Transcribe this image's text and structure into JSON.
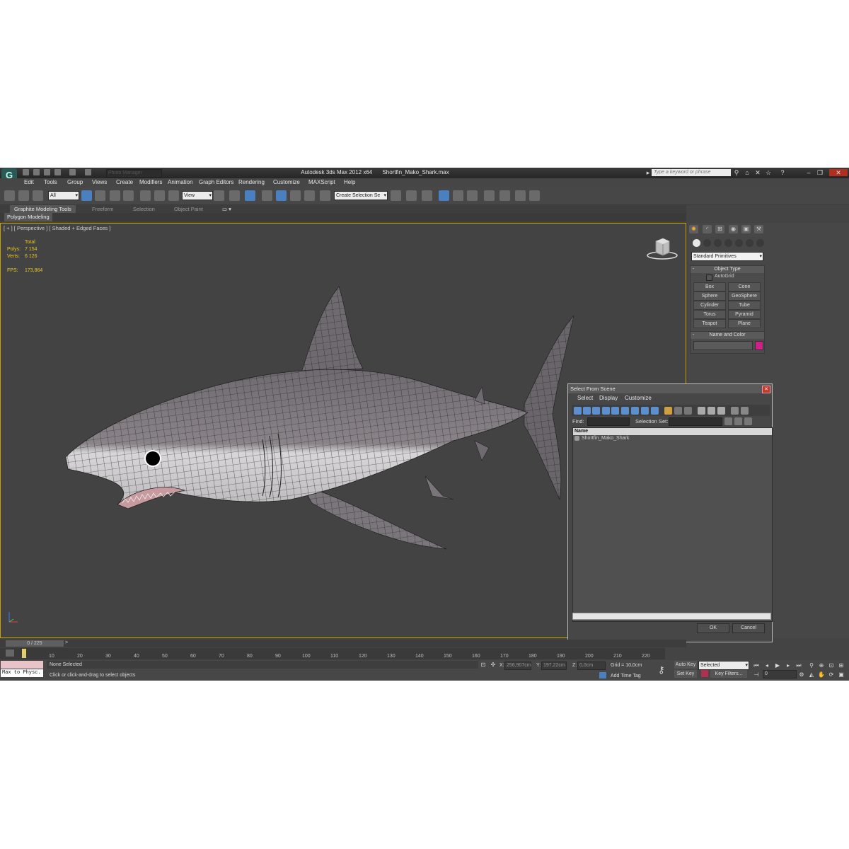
{
  "window": {
    "app_title": "Autodesk 3ds Max  2012 x64",
    "file_name": "Shortfin_Mako_Shark.max",
    "project_placeholder": "Photo Manager",
    "search_placeholder": "Type a keyword or phrase"
  },
  "menu": [
    "Edit",
    "Tools",
    "Group",
    "Views",
    "Create",
    "Modifiers",
    "Animation",
    "Graph Editors",
    "Rendering",
    "Customize",
    "MAXScript",
    "Help"
  ],
  "toolbar": {
    "filter_value": "All",
    "ref_coord_value": "View",
    "selection_set_placeholder": "Create Selection Se"
  },
  "ribbon": {
    "tabs": [
      "Graphite Modeling Tools",
      "Freeform",
      "Selection",
      "Object Paint"
    ],
    "panel": "Polygon Modeling"
  },
  "viewport": {
    "label": "[ + ] [ Perspective ] [ Shaded + Edged Faces ]",
    "stats": {
      "total_label": "Total",
      "polys_label": "Polys:",
      "polys_value": "7 154",
      "verts_label": "Verts:",
      "verts_value": "6 126",
      "fps_label": "FPS:",
      "fps_value": "173,864"
    }
  },
  "command_panel": {
    "category": "Standard Primitives",
    "object_type_title": "Object Type",
    "autogrid_label": "AutoGrid",
    "primitives": [
      "Box",
      "Cone",
      "Sphere",
      "GeoSphere",
      "Cylinder",
      "Tube",
      "Torus",
      "Pyramid",
      "Teapot",
      "Plane"
    ],
    "name_color_title": "Name and Color",
    "object_color": "#cc2288"
  },
  "dialog": {
    "title": "Select From Scene",
    "menus": [
      "Select",
      "Display",
      "Customize"
    ],
    "find_label": "Find:",
    "selection_set_label": "Selection Set:",
    "column_name": "Name",
    "items": [
      "Shortfin_Mako_Shark"
    ],
    "ok_label": "OK",
    "cancel_label": "Cancel"
  },
  "timeline": {
    "frame_display": "0 / 225",
    "ticks": [
      "0",
      "10",
      "20",
      "30",
      "40",
      "50",
      "60",
      "70",
      "80",
      "90",
      "100",
      "110",
      "120",
      "130",
      "140",
      "150",
      "160",
      "170",
      "180",
      "190",
      "200",
      "210",
      "220"
    ]
  },
  "status": {
    "maxscript_text": "Max to Physc.",
    "selection_text": "None Selected",
    "prompt_text": "Click or click-and-drag to select objects",
    "x_label": "X:",
    "x_value": "256,907cm",
    "y_label": "Y:",
    "y_value": "197,22cm",
    "z_label": "Z:",
    "z_value": "0,0cm",
    "grid_text": "Grid = 10,0cm",
    "add_time_tag": "Add Time Tag",
    "auto_key": "Auto Key",
    "set_key": "Set Key",
    "key_mode_value": "Selected",
    "key_filters": "Key Filters...",
    "current_frame": "0"
  }
}
